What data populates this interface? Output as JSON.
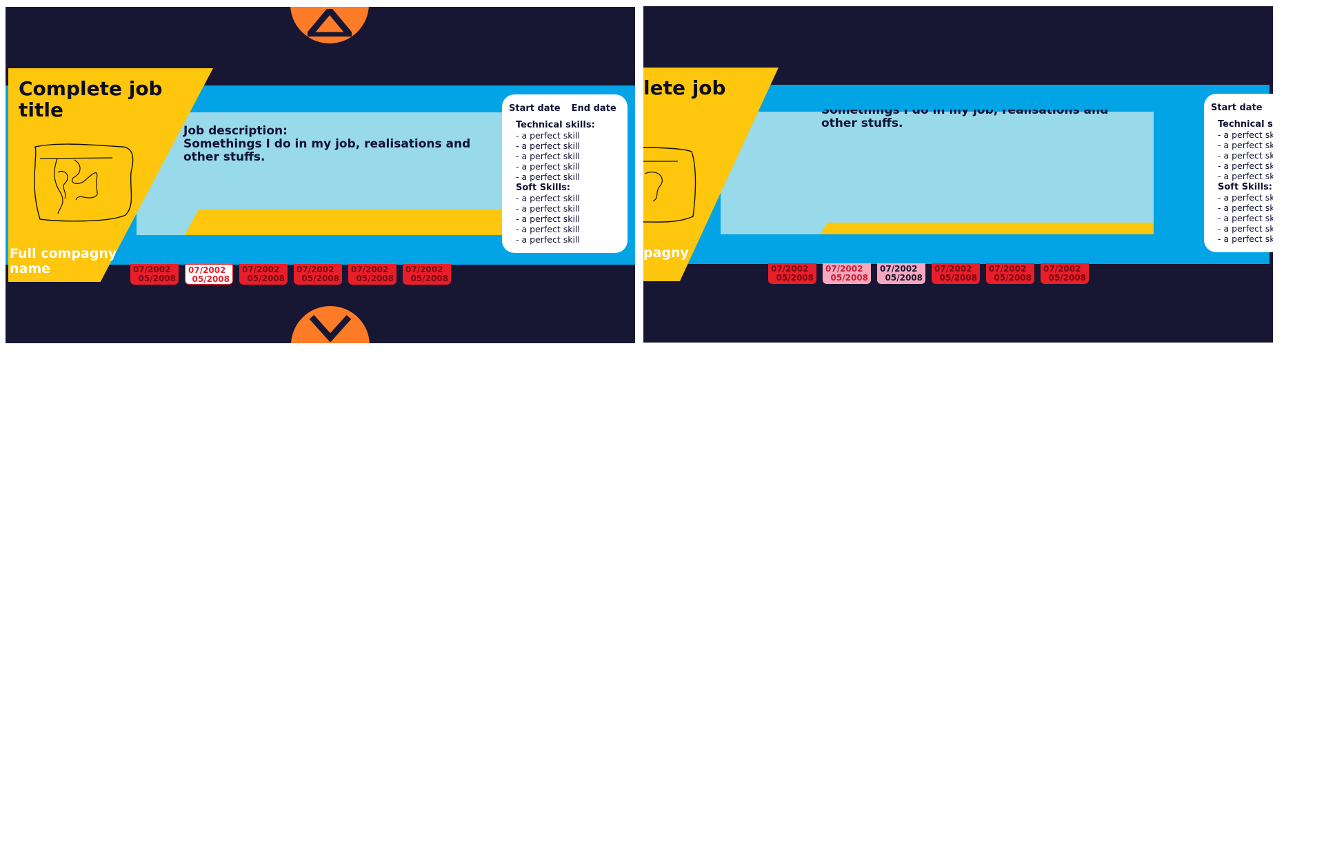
{
  "colors": {
    "background": "#171733",
    "stripe": "#02a4e6",
    "inner": "#98d9ea",
    "yellow": "#fec60c",
    "tab_red": "#e81e2b",
    "tab_pink": "#f7a8bf",
    "nav_orange": "#fe7c28"
  },
  "job": {
    "title": "Complete job title",
    "company": "Full compagny name",
    "description": "   Job description:\n   Somethings I do in my job, realisations and\nother stuffs.",
    "start_label": "Start date",
    "end_label": "End date"
  },
  "skills": {
    "technical_title": "Technical skills:",
    "technical": [
      "- a perfect skill",
      "- a perfect skill",
      "- a perfect skill",
      "- a perfect skill",
      "- a perfect skill"
    ],
    "soft_title": "Soft Skills:",
    "soft": [
      "- a perfect skill",
      "- a perfect skill",
      "- a perfect skill",
      "- a perfect skill",
      "- a perfect skill"
    ]
  },
  "right_view": {
    "title_partial": "lete job",
    "company_partial": "pagny",
    "description_partial": "   Somethings I do in my job, realisations and\nother stuffs.",
    "technical_title_partial": "Technical s",
    "soft_title": "Soft Skills:",
    "skill_partial": "- a perfect sk",
    "start_label": "Start date"
  },
  "timeline": [
    {
      "start": "07/2002",
      "end": "05/2008"
    },
    {
      "start": "07/2002",
      "end": "05/2008"
    },
    {
      "start": "07/2002",
      "end": "05/2008"
    },
    {
      "start": "07/2002",
      "end": "05/2008"
    },
    {
      "start": "07/2002",
      "end": "05/2008"
    },
    {
      "start": "07/2002",
      "end": "05/2008"
    }
  ],
  "nav": {
    "up_icon": "triangle-up-icon",
    "down_icon": "chevron-down-icon",
    "logo_icon": "company-logo-sketch"
  }
}
